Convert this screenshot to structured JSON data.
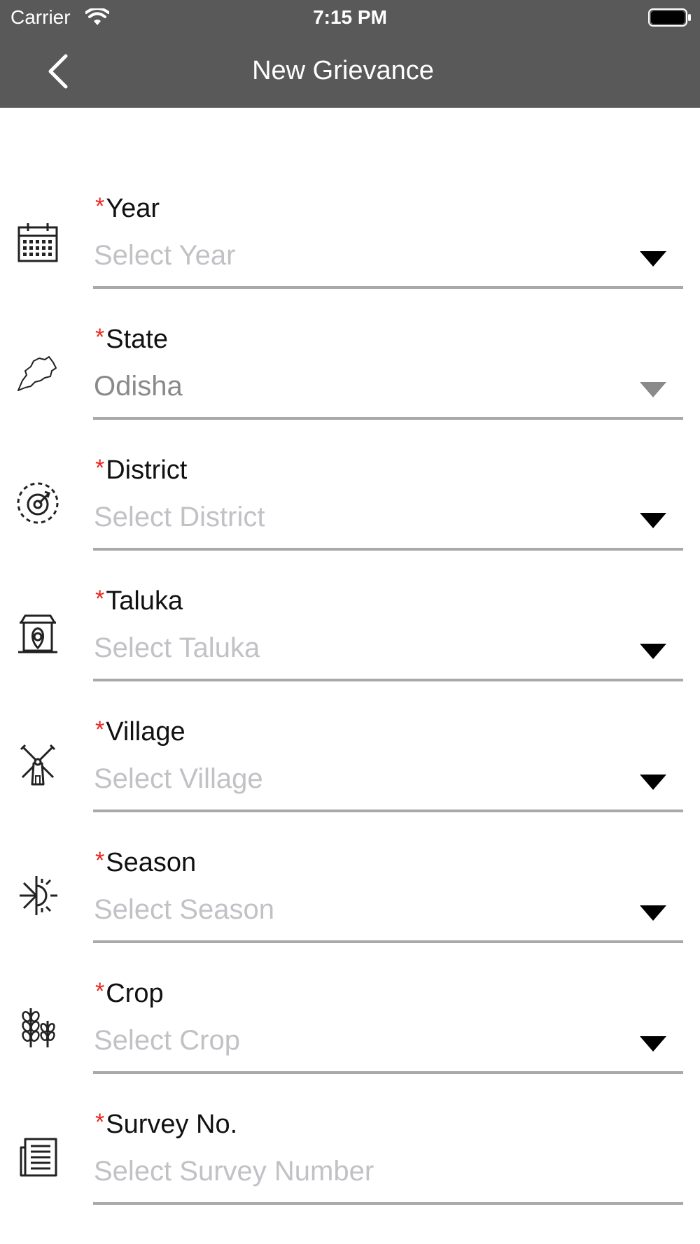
{
  "status_bar": {
    "carrier": "Carrier",
    "time": "7:15 PM"
  },
  "nav": {
    "title": "New Grievance",
    "back_icon": "chevron-left-icon"
  },
  "colors": {
    "header_bg": "#595959",
    "required_mark": "#e8261e",
    "placeholder": "#c1c1c6",
    "value_text": "#8a8a8a",
    "underline": "#a9a9a9"
  },
  "form": {
    "required_marker": "*",
    "fields": [
      {
        "label": "Year",
        "value": "Select Year",
        "icon": "calendar-icon",
        "has_dropdown": true,
        "filled": false
      },
      {
        "label": "State",
        "value": "Odisha",
        "icon": "state-map-icon",
        "has_dropdown": true,
        "filled": true
      },
      {
        "label": "District",
        "value": "Select District",
        "icon": "district-target-icon",
        "has_dropdown": true,
        "filled": false
      },
      {
        "label": "Taluka",
        "value": "Select Taluka",
        "icon": "taluka-building-icon",
        "has_dropdown": true,
        "filled": false
      },
      {
        "label": "Village",
        "value": "Select Village",
        "icon": "windmill-icon",
        "has_dropdown": true,
        "filled": false
      },
      {
        "label": "Season",
        "value": "Select Season",
        "icon": "season-sun-snow-icon",
        "has_dropdown": true,
        "filled": false
      },
      {
        "label": "Crop",
        "value": "Select Crop",
        "icon": "wheat-crop-icon",
        "has_dropdown": true,
        "filled": false
      },
      {
        "label": "Survey No.",
        "value": "Select Survey Number",
        "icon": "survey-document-icon",
        "has_dropdown": false,
        "filled": false
      }
    ]
  }
}
